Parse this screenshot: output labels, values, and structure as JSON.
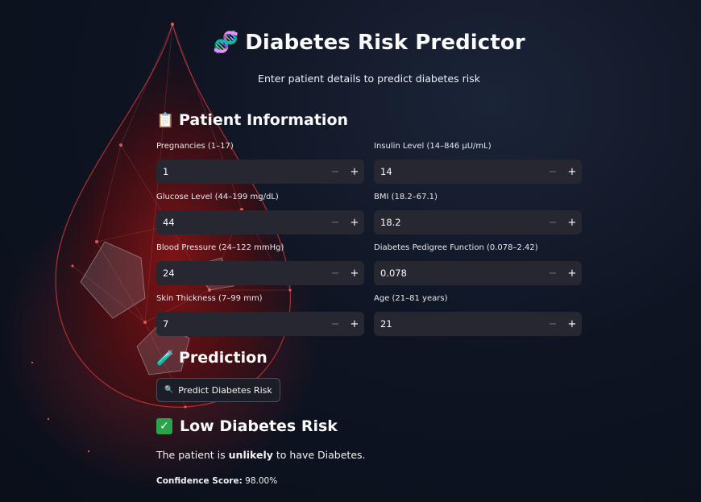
{
  "header": {
    "title_icon": "dna-icon",
    "title_emoji": "🧬",
    "title": "Diabetes Risk Predictor",
    "subtitle": "Enter patient details to predict diabetes risk"
  },
  "patient_section": {
    "icon": "clipboard-icon",
    "emoji": "📋",
    "heading": "Patient Information"
  },
  "fields": {
    "pregnancies": {
      "label": "Pregnancies (1–17)",
      "value": "1"
    },
    "insulin": {
      "label": "Insulin Level (14–846 µU/mL)",
      "value": "14"
    },
    "glucose": {
      "label": "Glucose Level (44–199 mg/dL)",
      "value": "44"
    },
    "bmi": {
      "label": "BMI (18.2–67.1)",
      "value": "18.2"
    },
    "blood_pressure": {
      "label": "Blood Pressure (24–122 mmHg)",
      "value": "24"
    },
    "dpf": {
      "label": "Diabetes Pedigree Function (0.078–2.42)",
      "value": "0.078"
    },
    "skin_thickness": {
      "label": "Skin Thickness (7–99 mm)",
      "value": "7"
    },
    "age": {
      "label": "Age (21–81 years)",
      "value": "21"
    }
  },
  "stepper": {
    "minus": "−",
    "plus": "+"
  },
  "prediction_section": {
    "icon": "test-tube-icon",
    "emoji": "🧪",
    "heading": "Prediction",
    "button_icon": "magnifier-icon",
    "button_emoji": "🔍",
    "button_label": "Predict Diabetes Risk"
  },
  "result": {
    "icon": "check-mark-icon",
    "check": "✓",
    "heading": "Low Diabetes Risk",
    "text_before": "The patient is ",
    "text_bold": "unlikely",
    "text_after": " to have Diabetes.",
    "confidence_label": "Confidence Score:",
    "confidence_value": " 98.00%"
  },
  "colors": {
    "background": "#0e1422",
    "input_bg": "#262730",
    "success_green": "#2aa44a",
    "accent_red": "#c0282d"
  }
}
